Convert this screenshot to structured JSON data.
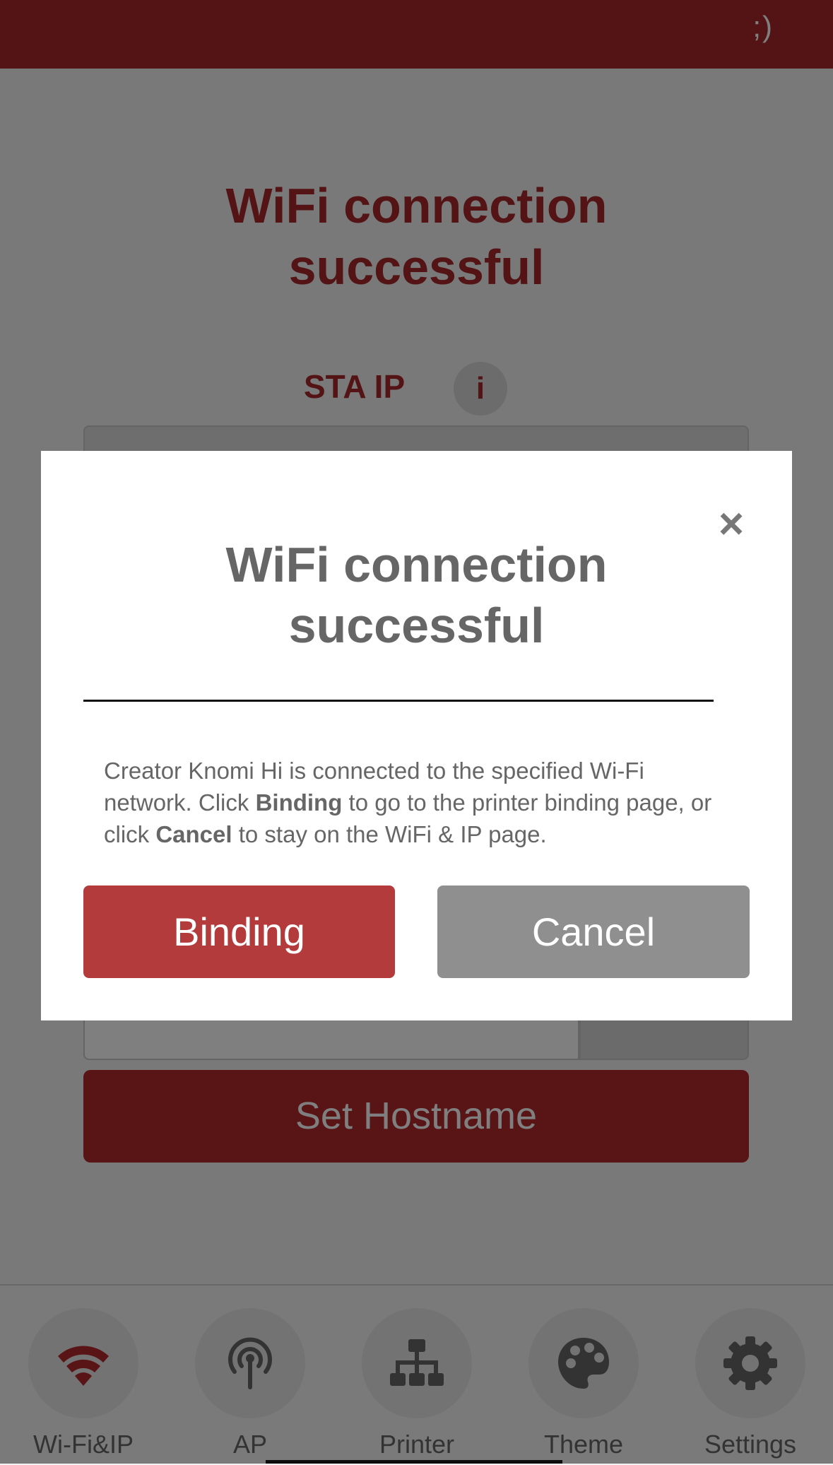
{
  "header": {
    "emoticon": ";)"
  },
  "page": {
    "title_line1": "WiFi connection",
    "title_line2": "successful",
    "sta_ip_label": "STA IP",
    "info_icon_text": "i",
    "set_hostname_label": "Set Hostname"
  },
  "modal": {
    "title_line1": "WiFi connection",
    "title_line2": "successful",
    "close_glyph": "×",
    "body_part1": "Creator Knomi Hi is connected to the specified Wi-Fi network. Click ",
    "body_bold1": "Binding",
    "body_part2": " to go to the printer binding page, or click ",
    "body_bold2": "Cancel",
    "body_part3": " to stay on the WiFi & IP page.",
    "binding_label": "Binding",
    "cancel_label": "Cancel"
  },
  "tabs": [
    {
      "label": "Wi-Fi&IP",
      "icon": "wifi-icon",
      "active": true
    },
    {
      "label": "AP",
      "icon": "antenna-icon",
      "active": false
    },
    {
      "label": "Printer",
      "icon": "network-icon",
      "active": false
    },
    {
      "label": "Theme",
      "icon": "palette-icon",
      "active": false
    },
    {
      "label": "Settings",
      "icon": "gear-icon",
      "active": false
    }
  ],
  "colors": {
    "brand_red": "#a8282b",
    "binding_red": "#b33b3b",
    "cancel_gray": "#8f8f8f",
    "icon_gray": "#666666"
  }
}
